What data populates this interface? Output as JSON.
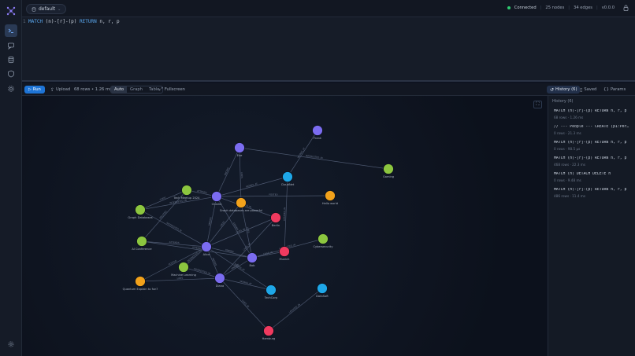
{
  "app": {
    "logo_icon": "network-logo-icon"
  },
  "rail": {
    "items": [
      "terminal-icon",
      "chat-icon",
      "database-icon",
      "shield-icon",
      "gear-icon"
    ],
    "bottom": "settings-icon"
  },
  "topbar": {
    "database": "default",
    "status_text": "Connected",
    "nodes": "25 nodes",
    "edges": "34 edges",
    "version": "v0.0.0",
    "status_color": "#2ecc71"
  },
  "editor": {
    "line_number": "1",
    "query_kw1": "MATCH",
    "query_mid": " (n)-[r]-(p) ",
    "query_kw2": "RETURN",
    "query_tail": " n, r, p"
  },
  "toolbar": {
    "run": "Run",
    "upload": "Upload",
    "result_info": "68 rows • 1.26 ms",
    "modes": [
      "Auto",
      "Graph",
      "Table"
    ],
    "active_mode": "Auto",
    "fullscreen": "Fullscreen",
    "history": "History (6)",
    "saved": "Saved",
    "params": "Params"
  },
  "history": {
    "title": "History (6)",
    "items": [
      {
        "query": "MATCH (n)-[r]-(p) RETURN n, r, p",
        "meta": "68 rows · 1.26 ms"
      },
      {
        "query": "// --- People --- CREATE (p1:Per…",
        "meta": "0 rows · 21.3 ms"
      },
      {
        "query": "MATCH (n)-[r]-(p) RETURN n, r, p",
        "meta": "0 rows · 98.5 µs"
      },
      {
        "query": "MATCH (n)-[r]-(p) RETURN n, r, p",
        "meta": "468 rows · 22.3 ms"
      },
      {
        "query": "MATCH (n) DETACH DELETE n",
        "meta": "0 rows · 9.48 ms"
      },
      {
        "query": "MATCH (n)-[r]-(p) RETURN n, r, p",
        "meta": "486 rows · 11.4 ms"
      }
    ]
  },
  "graph": {
    "colors": {
      "person": "#7b6cf0",
      "company": "#1ea7e8",
      "topic": "#8cc63f",
      "city": "#f03a5f",
      "project": "#f2a21b"
    },
    "nodes": [
      {
        "id": "frank",
        "label": "Frank",
        "type": "person"
      },
      {
        "id": "eve",
        "label": "Eve",
        "type": "person"
      },
      {
        "id": "gaming",
        "label": "Gaming",
        "type": "topic"
      },
      {
        "id": "cloudnet",
        "label": "CloudNet",
        "type": "company"
      },
      {
        "id": "hello",
        "label": "Hello world",
        "type": "project"
      },
      {
        "id": "tech",
        "label": "Tech Meetup 2024",
        "type": "topic"
      },
      {
        "id": "charlie",
        "label": "Charlie",
        "type": "person"
      },
      {
        "id": "graphdb",
        "label": "Graph databases are powerful",
        "type": "project"
      },
      {
        "id": "graphdatabases",
        "label": "Graph Databases",
        "type": "topic"
      },
      {
        "id": "berlin",
        "label": "Berlin",
        "type": "city"
      },
      {
        "id": "ai",
        "label": "AI Conference",
        "type": "topic"
      },
      {
        "id": "cyber",
        "label": "Cybersecurity",
        "type": "topic"
      },
      {
        "id": "alice",
        "label": "Alice",
        "type": "person"
      },
      {
        "id": "munich",
        "label": "Munich",
        "type": "city"
      },
      {
        "id": "bob",
        "label": "Bob",
        "type": "person"
      },
      {
        "id": "ml",
        "label": "Machine Learning",
        "type": "topic"
      },
      {
        "id": "diana",
        "label": "Diana",
        "type": "person"
      },
      {
        "id": "quantum",
        "label": "Quantum Explain to fun?",
        "type": "project"
      },
      {
        "id": "techcorp",
        "label": "TechCorp",
        "type": "company"
      },
      {
        "id": "datasoft",
        "label": "DataSoft",
        "type": "company"
      },
      {
        "id": "hamburg",
        "label": "Hamburg",
        "type": "city"
      }
    ],
    "edges": [
      {
        "from": "frank",
        "to": "cloudnet",
        "label": "WORKS_AT"
      },
      {
        "from": "eve",
        "to": "gaming",
        "label": "INTERESTED_IN"
      },
      {
        "from": "eve",
        "to": "charlie",
        "label": "KNOWS"
      },
      {
        "from": "eve",
        "to": "graphdb",
        "label": "LIKES"
      },
      {
        "from": "cloudnet",
        "to": "charlie",
        "label": "WORKS_AT"
      },
      {
        "from": "cloudnet",
        "to": "munich",
        "label": "LOCATED_IN"
      },
      {
        "from": "charlie",
        "to": "hello",
        "label": "POSTED"
      },
      {
        "from": "charlie",
        "to": "tech",
        "label": "ATTENDS"
      },
      {
        "from": "charlie",
        "to": "graphdatabases",
        "label": "INTERESTED_IN"
      },
      {
        "from": "charlie",
        "to": "alice",
        "label": "KNOWS"
      },
      {
        "from": "charlie",
        "to": "berlin",
        "label": "LIVES_IN"
      },
      {
        "from": "charlie",
        "to": "bob",
        "label": "KNOWS"
      },
      {
        "from": "tech",
        "to": "graphdatabases",
        "label": "TOPIC"
      },
      {
        "from": "graphdatabases",
        "to": "alice",
        "label": "INTERESTED_IN"
      },
      {
        "from": "ai",
        "to": "alice",
        "label": "ATTENDS"
      },
      {
        "from": "ai",
        "to": "bob",
        "label": "ATTENDS"
      },
      {
        "from": "ai",
        "to": "tech",
        "label": "RELATED"
      },
      {
        "from": "graphdb",
        "to": "alice",
        "label": "LIKES"
      },
      {
        "from": "graphdb",
        "to": "bob",
        "label": "LIKES"
      },
      {
        "from": "berlin",
        "to": "diana",
        "label": "LIVES_IN"
      },
      {
        "from": "berlin",
        "to": "alice",
        "label": "LIVES_IN"
      },
      {
        "from": "alice",
        "to": "bob",
        "label": "KNOWS"
      },
      {
        "from": "alice",
        "to": "ml",
        "label": "INTERESTED_IN"
      },
      {
        "from": "alice",
        "to": "techcorp",
        "label": "WORKS_AT"
      },
      {
        "from": "alice",
        "to": "diana",
        "label": "KNOWS"
      },
      {
        "from": "bob",
        "to": "munich",
        "label": "LIVES_IN"
      },
      {
        "from": "bob",
        "to": "diana",
        "label": "KNOWS"
      },
      {
        "from": "bob",
        "to": "cyber",
        "label": "INTERESTED_IN"
      },
      {
        "from": "ml",
        "to": "diana",
        "label": "INTERESTED_IN"
      },
      {
        "from": "quantum",
        "to": "alice",
        "label": "POSTED"
      },
      {
        "from": "quantum",
        "to": "diana",
        "label": "LIKES"
      },
      {
        "from": "diana",
        "to": "techcorp",
        "label": "WORKS_AT"
      },
      {
        "from": "datasoft",
        "to": "hamburg",
        "label": "LOCATED_IN"
      },
      {
        "from": "diana",
        "to": "hamburg",
        "label": "LIVES_IN"
      }
    ]
  }
}
